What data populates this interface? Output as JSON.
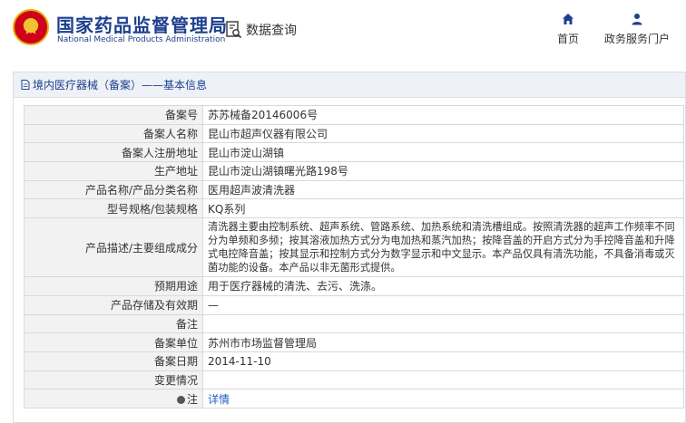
{
  "header": {
    "title_cn": "国家药品监督管理局",
    "title_en": "National Medical Products Administration",
    "search_label": "数据查询",
    "nav": [
      {
        "label": "首页",
        "icon": "home-icon"
      },
      {
        "label": "政务服务门户",
        "icon": "user-icon"
      }
    ]
  },
  "panel": {
    "breadcrumb": "境内医疗器械（备案）——基本信息"
  },
  "record": {
    "rows": [
      {
        "label": "备案号",
        "value": "苏苏械备20146006号"
      },
      {
        "label": "备案人名称",
        "value": "昆山市超声仪器有限公司"
      },
      {
        "label": "备案人注册地址",
        "value": "昆山市淀山湖镇"
      },
      {
        "label": "生产地址",
        "value": "昆山市淀山湖镇曙光路198号"
      },
      {
        "label": "产品名称/产品分类名称",
        "value": "医用超声波清洗器"
      },
      {
        "label": "型号规格/包装规格",
        "value": "KQ系列"
      },
      {
        "label": "产品描述/主要组成成分",
        "value": "清洗器主要由控制系统、超声系统、管路系统、加热系统和清洗槽组成。按照清洗器的超声工作频率不同分为单频和多频；按其溶液加热方式分为电加热和蒸汽加热；按降音盖的开启方式分为手控降音盖和升降式电控降音盖；按其显示和控制方式分为数字显示和中文显示。本产品仅具有清洗功能，不具备消毒或灭菌功能的设备。本产品以非无菌形式提供。"
      },
      {
        "label": "预期用途",
        "value": "用于医疗器械的清洗、去污、洗涤。"
      },
      {
        "label": "产品存储及有效期",
        "value": "—"
      },
      {
        "label": "备注",
        "value": ""
      },
      {
        "label": "备案单位",
        "value": "苏州市市场监督管理局"
      },
      {
        "label": "备案日期",
        "value": "2014-11-10"
      },
      {
        "label": "变更情况",
        "value": ""
      },
      {
        "label": "注",
        "value": "详情"
      }
    ]
  },
  "colors": {
    "brand_blue": "#1d3f8f",
    "link_blue": "#1d5fbf",
    "label_bg": "#f2f2f2",
    "panel_head_bg": "#eef1f6"
  }
}
